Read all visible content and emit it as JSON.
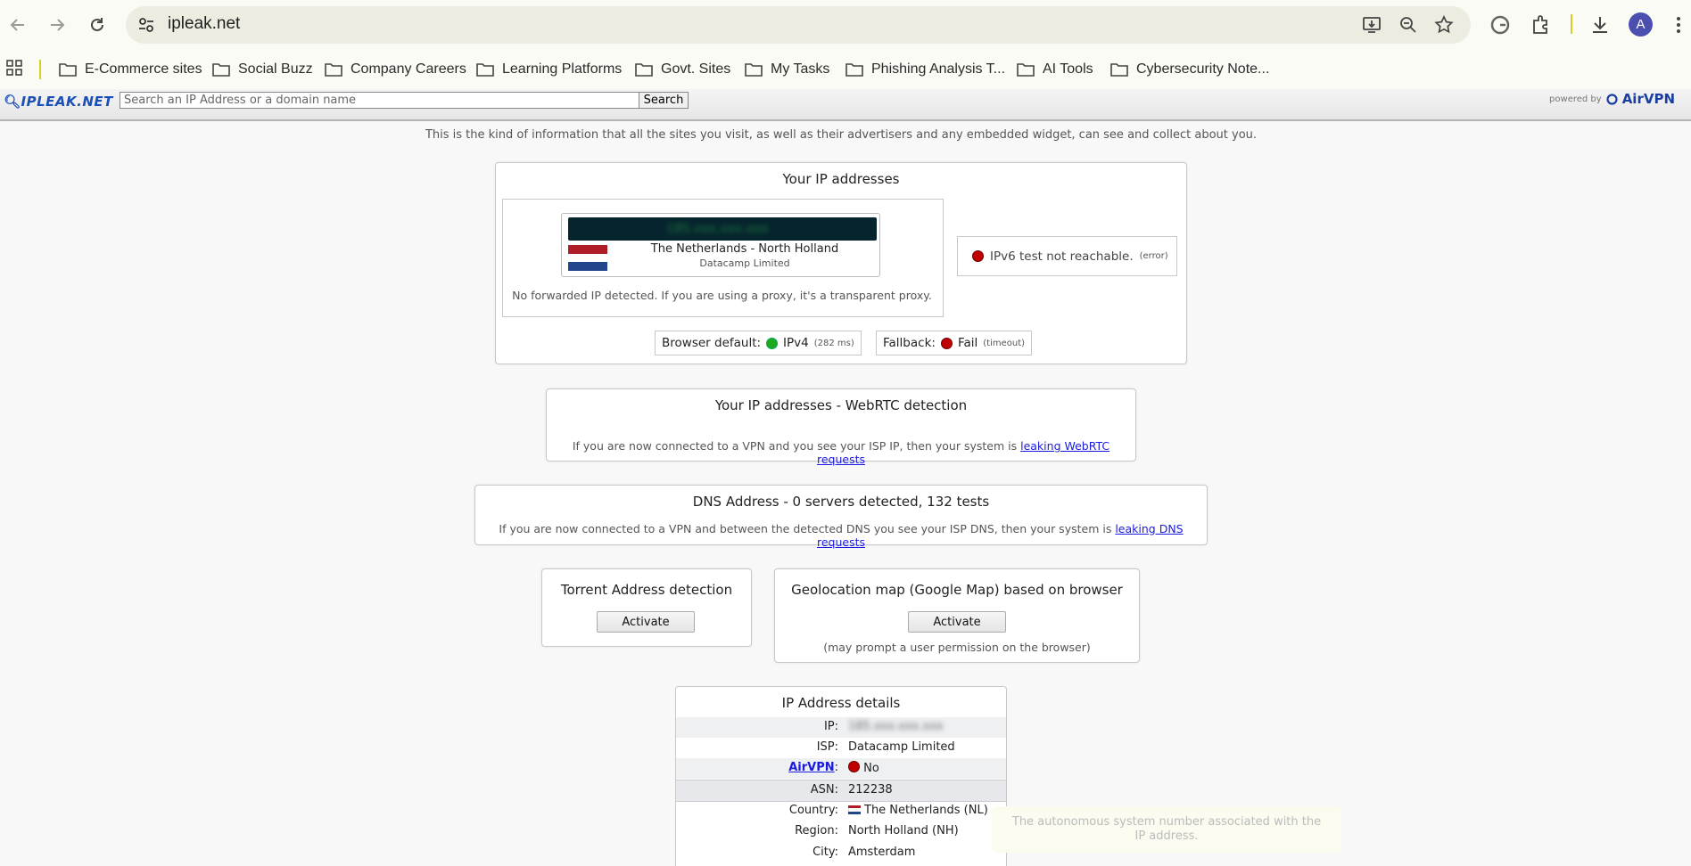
{
  "browser": {
    "url": "ipleak.net",
    "avatar_letter": "A",
    "bookmarks": [
      "E-Commerce sites",
      "Social Buzz",
      "Company Careers",
      "Learning Platforms",
      "Govt. Sites",
      "My Tasks",
      "Phishing Analysis T...",
      "AI Tools",
      "Cybersecurity Note..."
    ]
  },
  "site": {
    "logo": "IPLEAK.NET",
    "search_placeholder": "Search an IP Address or a domain name",
    "search_button": "Search",
    "powered_by": "powered by",
    "powered_brand": "AirVPN",
    "intro": "This is the kind of information that all the sites you visit, as well as their advertisers and any embedded widget, can see and collect about you."
  },
  "ip_section": {
    "title": "Your IP addresses",
    "ip_value": "185.xxx.xxx.xxx",
    "location": "The Netherlands - North Holland",
    "provider": "Datacamp Limited",
    "forward_note": "No forwarded IP detected. If you are using a proxy, it's a transparent proxy.",
    "ipv6_text": "IPv6 test not reachable.",
    "ipv6_detail": "(error)",
    "browser_default_label": "Browser default:",
    "browser_default_value": "IPv4",
    "browser_default_detail": "(282 ms)",
    "fallback_label": "Fallback:",
    "fallback_value": "Fail",
    "fallback_detail": "(timeout)"
  },
  "webrtc": {
    "title": "Your IP addresses - WebRTC detection",
    "note": "If you are now connected to a VPN and you see your ISP IP, then your system is",
    "link": "leaking WebRTC requests"
  },
  "dns": {
    "title": "DNS Address - 0 servers detected, 132 tests",
    "note": "If you are now connected to a VPN and between the detected DNS you see your ISP DNS, then your system is",
    "link": "leaking DNS requests"
  },
  "torrent": {
    "title": "Torrent Address detection",
    "button": "Activate"
  },
  "geo": {
    "title": "Geolocation map (Google Map) based on browser",
    "button": "Activate",
    "note": "(may prompt a user permission on the browser)"
  },
  "details": {
    "title": "IP Address details",
    "rows": [
      {
        "key": "IP:",
        "value": "185.xxx.xxx.xxx"
      },
      {
        "key": "ISP:",
        "value": "Datacamp Limited"
      },
      {
        "key": "AirVPN",
        "value": "No"
      },
      {
        "key": "ASN:",
        "value": "212238"
      },
      {
        "key": "Country:",
        "value": "The Netherlands (NL)"
      },
      {
        "key": "Region:",
        "value": "North Holland (NH)"
      },
      {
        "key": "City:",
        "value": "Amsterdam"
      }
    ],
    "tooltip": "The autonomous system number associated with the IP address."
  },
  "colors": {
    "accent_link": "#1a1adf",
    "status_red": "#c20000",
    "status_green": "#1da81d"
  }
}
